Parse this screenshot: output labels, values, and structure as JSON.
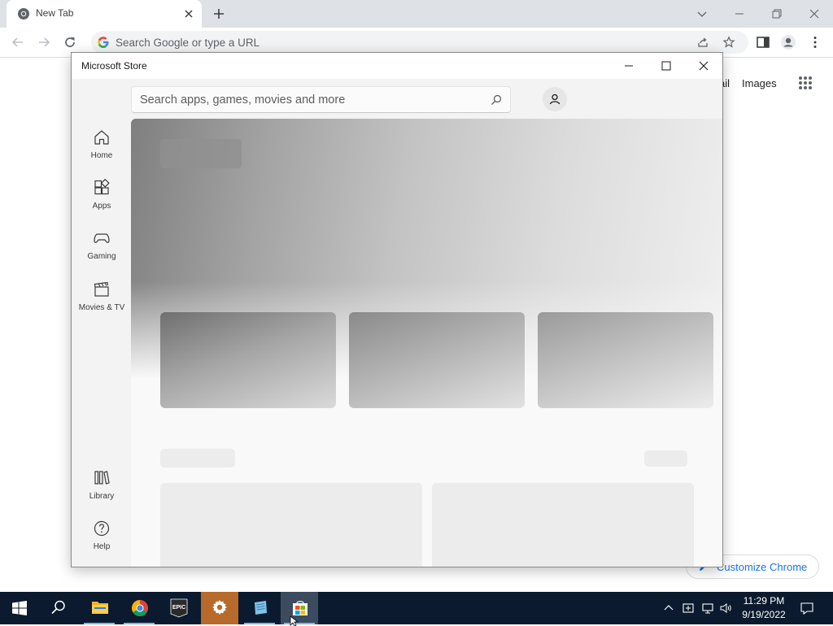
{
  "browser": {
    "tab": {
      "title": "New Tab"
    },
    "omnibox": {
      "placeholder": "Search Google or type a URL"
    },
    "ntp": {
      "gmail_link": "ail",
      "images_link": "Images",
      "customize_label": "Customize Chrome"
    }
  },
  "store": {
    "title": "Microsoft Store",
    "search": {
      "placeholder": "Search apps, games, movies and more"
    },
    "nav": {
      "home": "Home",
      "apps": "Apps",
      "gaming": "Gaming",
      "movies": "Movies & TV",
      "library": "Library",
      "help": "Help"
    }
  },
  "taskbar": {
    "clock": {
      "time": "11:29 PM",
      "date": "9/19/2022"
    },
    "apps": [
      "windows-start",
      "search",
      "file-explorer",
      "google-chrome",
      "epic-games",
      "settings",
      "notepad-blue",
      "microsoft-store"
    ],
    "epic_label": "EPIC"
  },
  "colors": {
    "taskbar_bg": "#0b1a2e",
    "chrome_accent": "#1a73e8",
    "active_indicator": "#76b9ed"
  }
}
